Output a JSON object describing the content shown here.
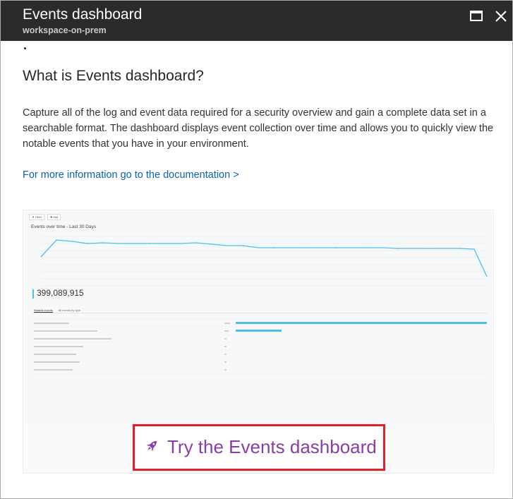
{
  "window": {
    "title": "Events dashboard",
    "subtitle": "workspace-on-prem",
    "maximize_icon": "maximize-icon",
    "close_icon": "close-icon"
  },
  "content": {
    "heading": "What is Events dashboard?",
    "description": "Capture all of the log and event data required for a security overview and gain a complete data set in a searchable format. The dashboard displays event collection over time and allows you to quickly view the notable events that you have in your environment.",
    "doc_link": "For more information go to the documentation >"
  },
  "preview": {
    "chart_title": "Events over time - Last 30 Days",
    "total": "399,089,915",
    "tabs": [
      "Notable events",
      "All events by type"
    ],
    "line_color": "#4cc0e6"
  },
  "cta": {
    "label": "Try the Events dashboard",
    "icon": "rocket-icon",
    "color": "#8a3ea5",
    "border_color": "#e21e2b"
  }
}
